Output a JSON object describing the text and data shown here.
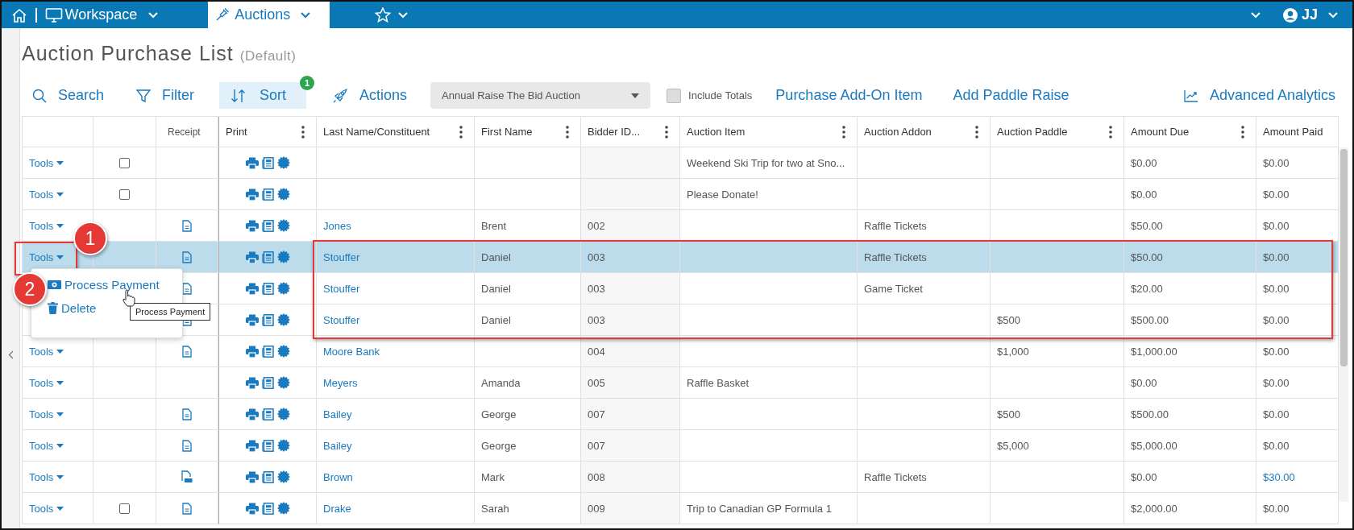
{
  "nav": {
    "workspace": "Workspace",
    "tab": "Auctions",
    "user": "JJ"
  },
  "page": {
    "title": "Auction Purchase List",
    "view": "(Default)"
  },
  "toolbar": {
    "search": "Search",
    "filter": "Filter",
    "sort": "Sort",
    "sort_count": "1",
    "actions": "Actions",
    "auction_select": "Annual Raise The Bid Auction",
    "include_totals": {
      "label": "Include Totals",
      "checked": false
    },
    "links": [
      "Purchase Add-On Item",
      "Add Paddle Raise"
    ],
    "analytics": "Advanced Analytics"
  },
  "table": {
    "columns": [
      {
        "label": "Receipt",
        "menu": false
      },
      {
        "label": "Print",
        "menu": true
      },
      {
        "label": "Last Name/Constituent",
        "menu": true
      },
      {
        "label": "First Name",
        "menu": true
      },
      {
        "label": "Bidder ID...",
        "menu": true
      },
      {
        "label": "Auction Item",
        "menu": true
      },
      {
        "label": "Auction Addon",
        "menu": true
      },
      {
        "label": "Auction Paddle",
        "menu": true
      },
      {
        "label": "Amount Due",
        "menu": true
      },
      {
        "label": "Amount Paid",
        "menu": false
      }
    ],
    "rows": [
      {
        "tools": "Tools",
        "checkbox": {
          "checked": false
        },
        "item": "Weekend Ski Trip for two at Sno...",
        "due": "$0.00",
        "paid": "$0.00",
        "paid_link": false,
        "selected": false
      },
      {
        "tools": "Tools",
        "checkbox": {
          "checked": false
        },
        "item": "Please Donate!",
        "due": "$0.00",
        "paid": "$0.00",
        "paid_link": false,
        "selected": false
      },
      {
        "tools": "Tools",
        "receipt": {
          "kind": "doc"
        },
        "last": "Jones",
        "first": "Brent",
        "bidder": "002",
        "addon": "Raffle Tickets",
        "due": "$50.00",
        "paid": "$0.00",
        "paid_link": false,
        "selected": false
      },
      {
        "tools": "Tools",
        "receipt": {
          "kind": "doc"
        },
        "last": "Stouffer",
        "first": "Daniel",
        "bidder": "003",
        "addon": "Raffle Tickets",
        "due": "$50.00",
        "paid": "$0.00",
        "paid_link": false,
        "selected": true
      },
      {
        "receipt": {
          "kind": "doc"
        },
        "last": "Stouffer",
        "first": "Daniel",
        "bidder": "003",
        "addon": "Game Ticket",
        "due": "$20.00",
        "paid": "$0.00",
        "paid_link": false,
        "selected": false
      },
      {
        "receipt": {
          "kind": "doc"
        },
        "last": "Stouffer",
        "first": "Daniel",
        "bidder": "003",
        "paddle": "$500",
        "due": "$500.00",
        "paid": "$0.00",
        "paid_link": false,
        "selected": false
      },
      {
        "tools": "Tools",
        "receipt": {
          "kind": "doc"
        },
        "last": "Moore Bank",
        "bidder": "004",
        "paddle": "$1,000",
        "due": "$1,000.00",
        "paid": "$0.00",
        "paid_link": false,
        "selected": false
      },
      {
        "tools": "Tools",
        "last": "Meyers",
        "first": "Amanda",
        "bidder": "005",
        "item": "Raffle Basket",
        "due": "$0.00",
        "paid": "$0.00",
        "paid_link": false,
        "selected": false
      },
      {
        "tools": "Tools",
        "receipt": {
          "kind": "doc"
        },
        "last": "Bailey",
        "first": "George",
        "bidder": "007",
        "paddle": "$500",
        "due": "$500.00",
        "paid": "$0.00",
        "paid_link": false,
        "selected": false
      },
      {
        "tools": "Tools",
        "receipt": {
          "kind": "doc"
        },
        "last": "Bailey",
        "first": "George",
        "bidder": "007",
        "paddle": "$5,000",
        "due": "$5,000.00",
        "paid": "$0.00",
        "paid_link": false,
        "selected": false
      },
      {
        "tools": "Tools",
        "receipt": {
          "kind": "pdf"
        },
        "last": "Brown",
        "first": "Mark",
        "bidder": "008",
        "addon": "Raffle Tickets",
        "due": "$0.00",
        "paid": "$30.00",
        "paid_link": true,
        "selected": false
      },
      {
        "tools": "Tools",
        "checkbox": {
          "checked": false
        },
        "receipt": {
          "kind": "doc"
        },
        "last": "Drake",
        "first": "Sarah",
        "bidder": "009",
        "item": "Trip to Canadian GP Formula 1",
        "due": "$2,000.00",
        "paid": "$0.00",
        "paid_link": false,
        "selected": false
      }
    ]
  },
  "tools_menu": {
    "items": [
      {
        "kind": "payment",
        "label": "Process Payment"
      },
      {
        "kind": "delete",
        "label": "Delete"
      }
    ]
  },
  "tooltip": "Process Payment",
  "callouts": [
    "1",
    "2"
  ]
}
